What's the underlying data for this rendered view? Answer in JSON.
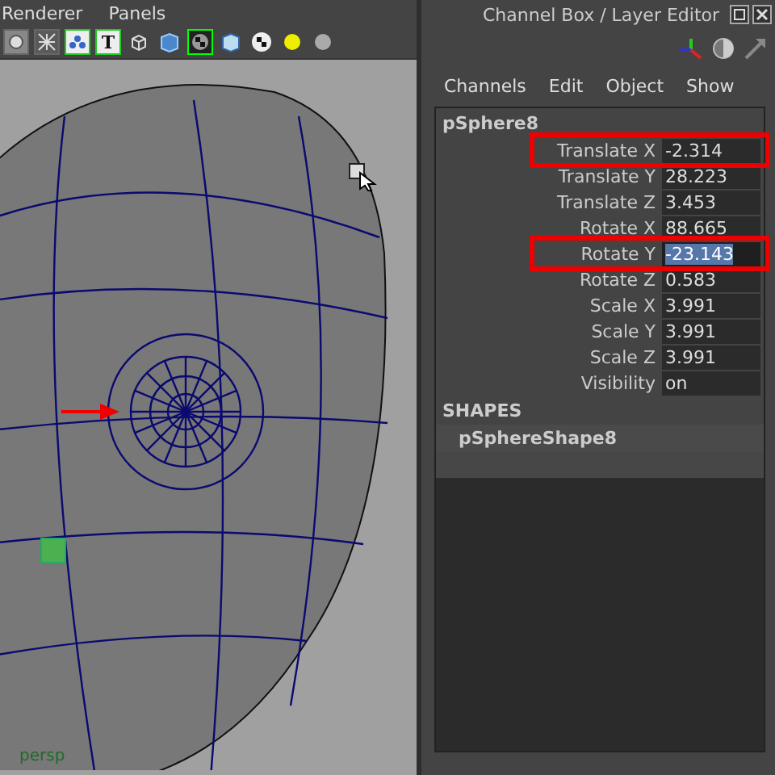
{
  "viewport": {
    "menu": [
      "Renderer",
      "Panels"
    ],
    "toolbar_text_icon": "T",
    "camera_label": "persp"
  },
  "channel_box": {
    "title": "Channel Box / Layer Editor",
    "menu": [
      "Channels",
      "Edit",
      "Object",
      "Show"
    ],
    "object_name": "pSphere8",
    "attributes": [
      {
        "label": "Translate X",
        "value": "-2.314",
        "highlighted": true,
        "editing": false
      },
      {
        "label": "Translate Y",
        "value": "28.223",
        "highlighted": false,
        "editing": false
      },
      {
        "label": "Translate Z",
        "value": "3.453",
        "highlighted": false,
        "editing": false
      },
      {
        "label": "Rotate X",
        "value": "88.665",
        "highlighted": false,
        "editing": false
      },
      {
        "label": "Rotate Y",
        "value": "-23.143",
        "highlighted": true,
        "editing": true
      },
      {
        "label": "Rotate Z",
        "value": "0.583",
        "highlighted": false,
        "editing": false
      },
      {
        "label": "Scale X",
        "value": "3.991",
        "highlighted": false,
        "editing": false
      },
      {
        "label": "Scale Y",
        "value": "3.991",
        "highlighted": false,
        "editing": false
      },
      {
        "label": "Scale Z",
        "value": "3.991",
        "highlighted": false,
        "editing": false
      },
      {
        "label": "Visibility",
        "value": "on",
        "highlighted": false,
        "editing": false
      }
    ],
    "shapes_heading": "SHAPES",
    "shape_name": "pSphereShape8"
  }
}
